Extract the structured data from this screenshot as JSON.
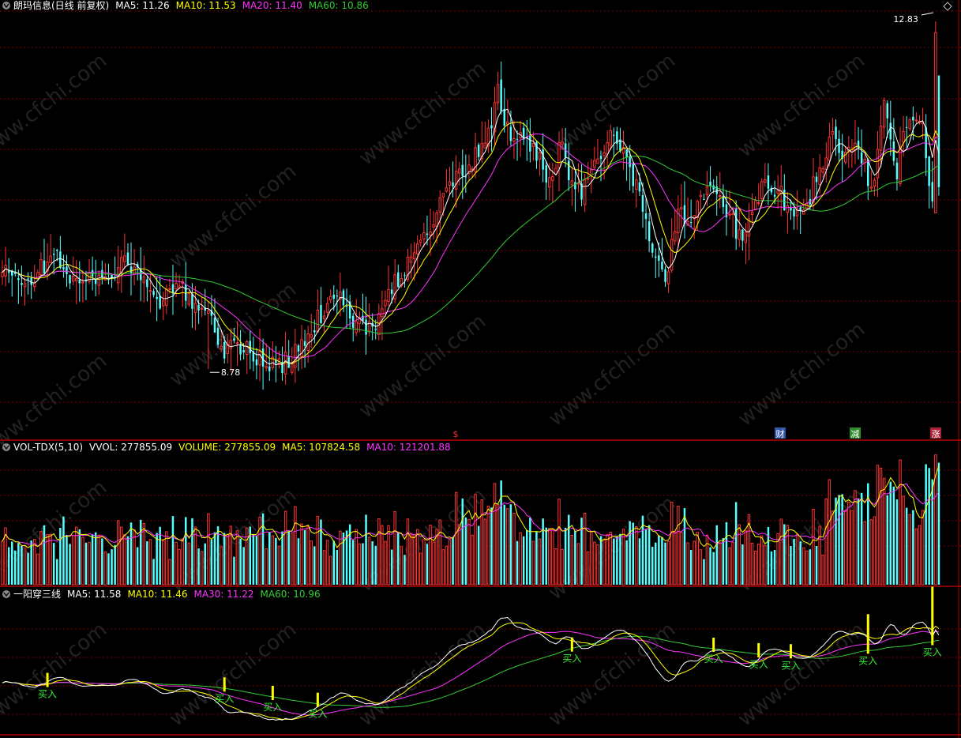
{
  "main_header": {
    "title": "朗玛信息(日线 前复权)",
    "items": [
      {
        "text": "MA5: 11.26",
        "color": "#ffffff"
      },
      {
        "text": "MA10: 11.53",
        "color": "#ffff00"
      },
      {
        "text": "MA20: 11.40",
        "color": "#ff33ff"
      },
      {
        "text": "MA60: 10.86",
        "color": "#33cc33"
      }
    ]
  },
  "vol_header": {
    "title": "VOL-TDX(5,10)",
    "items": [
      {
        "text": "VVOL: 277855.09",
        "color": "#ffffff"
      },
      {
        "text": "VOLUME: 277855.09",
        "color": "#ffff00"
      },
      {
        "text": "MA5: 107824.58",
        "color": "#ffff00"
      },
      {
        "text": "MA10: 121201.88",
        "color": "#ff33ff"
      }
    ]
  },
  "ind_header": {
    "title": "一阳穿三线",
    "items": [
      {
        "text": "MA5: 11.58",
        "color": "#ffffff"
      },
      {
        "text": "MA10: 11.46",
        "color": "#ffff00"
      },
      {
        "text": "MA30: 11.22",
        "color": "#ff33ff"
      },
      {
        "text": "MA60: 10.96",
        "color": "#33cc33"
      }
    ]
  },
  "price_annotations": {
    "high": "12.83",
    "low": "8.78"
  },
  "event_markers": [
    {
      "text": "$",
      "color": "#ff3333",
      "bg": ""
    },
    {
      "text": "财",
      "color": "#ffffff",
      "bg": "#3355aa"
    },
    {
      "text": "减",
      "color": "#ffffff",
      "bg": "#2e8b2e"
    },
    {
      "text": "涨",
      "color": "#ffffff",
      "bg": "#aa2233"
    }
  ],
  "buy_signal_label": "买入",
  "watermark": "www.cfchi.com",
  "colors": {
    "up": "#ff3333",
    "down": "#54ffff",
    "grid": "#7a0000",
    "frame": "#b00000",
    "ma5": "#ffffff",
    "ma10": "#ffff00",
    "ma20": "#ff33ff",
    "ma60": "#33cc33",
    "buy_bar": "#ffff00",
    "buy_text": "#33ee33"
  },
  "chart_data": [
    {
      "type": "candlestick",
      "panel": "price",
      "title": "朗玛信息(日线 前复权)",
      "ylim": [
        8.0,
        12.95
      ],
      "high_point": 12.83,
      "low_point": 8.78,
      "close_path": [
        [
          0,
          9.9
        ],
        [
          8,
          9.8
        ],
        [
          16,
          10.1
        ],
        [
          24,
          9.75
        ],
        [
          32,
          9.9
        ],
        [
          40,
          10.0
        ],
        [
          48,
          9.55
        ],
        [
          56,
          9.7
        ],
        [
          64,
          9.45
        ],
        [
          68,
          9.0
        ],
        [
          72,
          9.1
        ],
        [
          78,
          8.95
        ],
        [
          84,
          8.8
        ],
        [
          90,
          8.9
        ],
        [
          96,
          9.2
        ],
        [
          100,
          9.5
        ],
        [
          104,
          9.7
        ],
        [
          108,
          9.4
        ],
        [
          112,
          9.3
        ],
        [
          116,
          9.2
        ],
        [
          120,
          9.7
        ],
        [
          126,
          10.0
        ],
        [
          132,
          10.4
        ],
        [
          138,
          10.8
        ],
        [
          142,
          11.05
        ],
        [
          146,
          11.2
        ],
        [
          150,
          11.35
        ],
        [
          154,
          12.0
        ],
        [
          158,
          11.4
        ],
        [
          162,
          11.5
        ],
        [
          166,
          11.3
        ],
        [
          170,
          11.0
        ],
        [
          174,
          11.4
        ],
        [
          178,
          10.8
        ],
        [
          182,
          10.9
        ],
        [
          186,
          11.3
        ],
        [
          190,
          11.5
        ],
        [
          194,
          11.2
        ],
        [
          198,
          10.8
        ],
        [
          202,
          10.2
        ],
        [
          206,
          9.8
        ],
        [
          210,
          10.6
        ],
        [
          214,
          10.5
        ],
        [
          218,
          10.8
        ],
        [
          222,
          10.9
        ],
        [
          226,
          10.6
        ],
        [
          230,
          10.2
        ],
        [
          234,
          10.7
        ],
        [
          238,
          11.0
        ],
        [
          242,
          10.8
        ],
        [
          246,
          10.6
        ],
        [
          250,
          10.7
        ],
        [
          254,
          11.1
        ],
        [
          258,
          11.5
        ],
        [
          262,
          11.2
        ],
        [
          266,
          11.4
        ],
        [
          270,
          10.8
        ],
        [
          274,
          12.0
        ],
        [
          278,
          11.1
        ],
        [
          282,
          11.8
        ],
        [
          286,
          11.6
        ],
        [
          289,
          10.7
        ],
        [
          291,
          10.9
        ]
      ]
    },
    {
      "type": "bar",
      "panel": "volume",
      "title": "VOL-TDX(5,10)",
      "series": [
        {
          "name": "VVOL",
          "last": 277855.09
        },
        {
          "name": "VOLUME",
          "last": 277855.09
        },
        {
          "name": "MA5",
          "last": 107824.58
        },
        {
          "name": "MA10",
          "last": 121201.88
        }
      ]
    },
    {
      "type": "line",
      "panel": "indicator",
      "title": "一阳穿三线",
      "series": [
        {
          "name": "MA5",
          "last": 11.58
        },
        {
          "name": "MA10",
          "last": 11.46
        },
        {
          "name": "MA30",
          "last": 11.22
        },
        {
          "name": "MA60",
          "last": 10.96
        }
      ],
      "buy_signal_days": [
        14,
        69,
        84,
        98,
        177,
        221,
        235,
        245,
        269,
        289
      ]
    }
  ]
}
